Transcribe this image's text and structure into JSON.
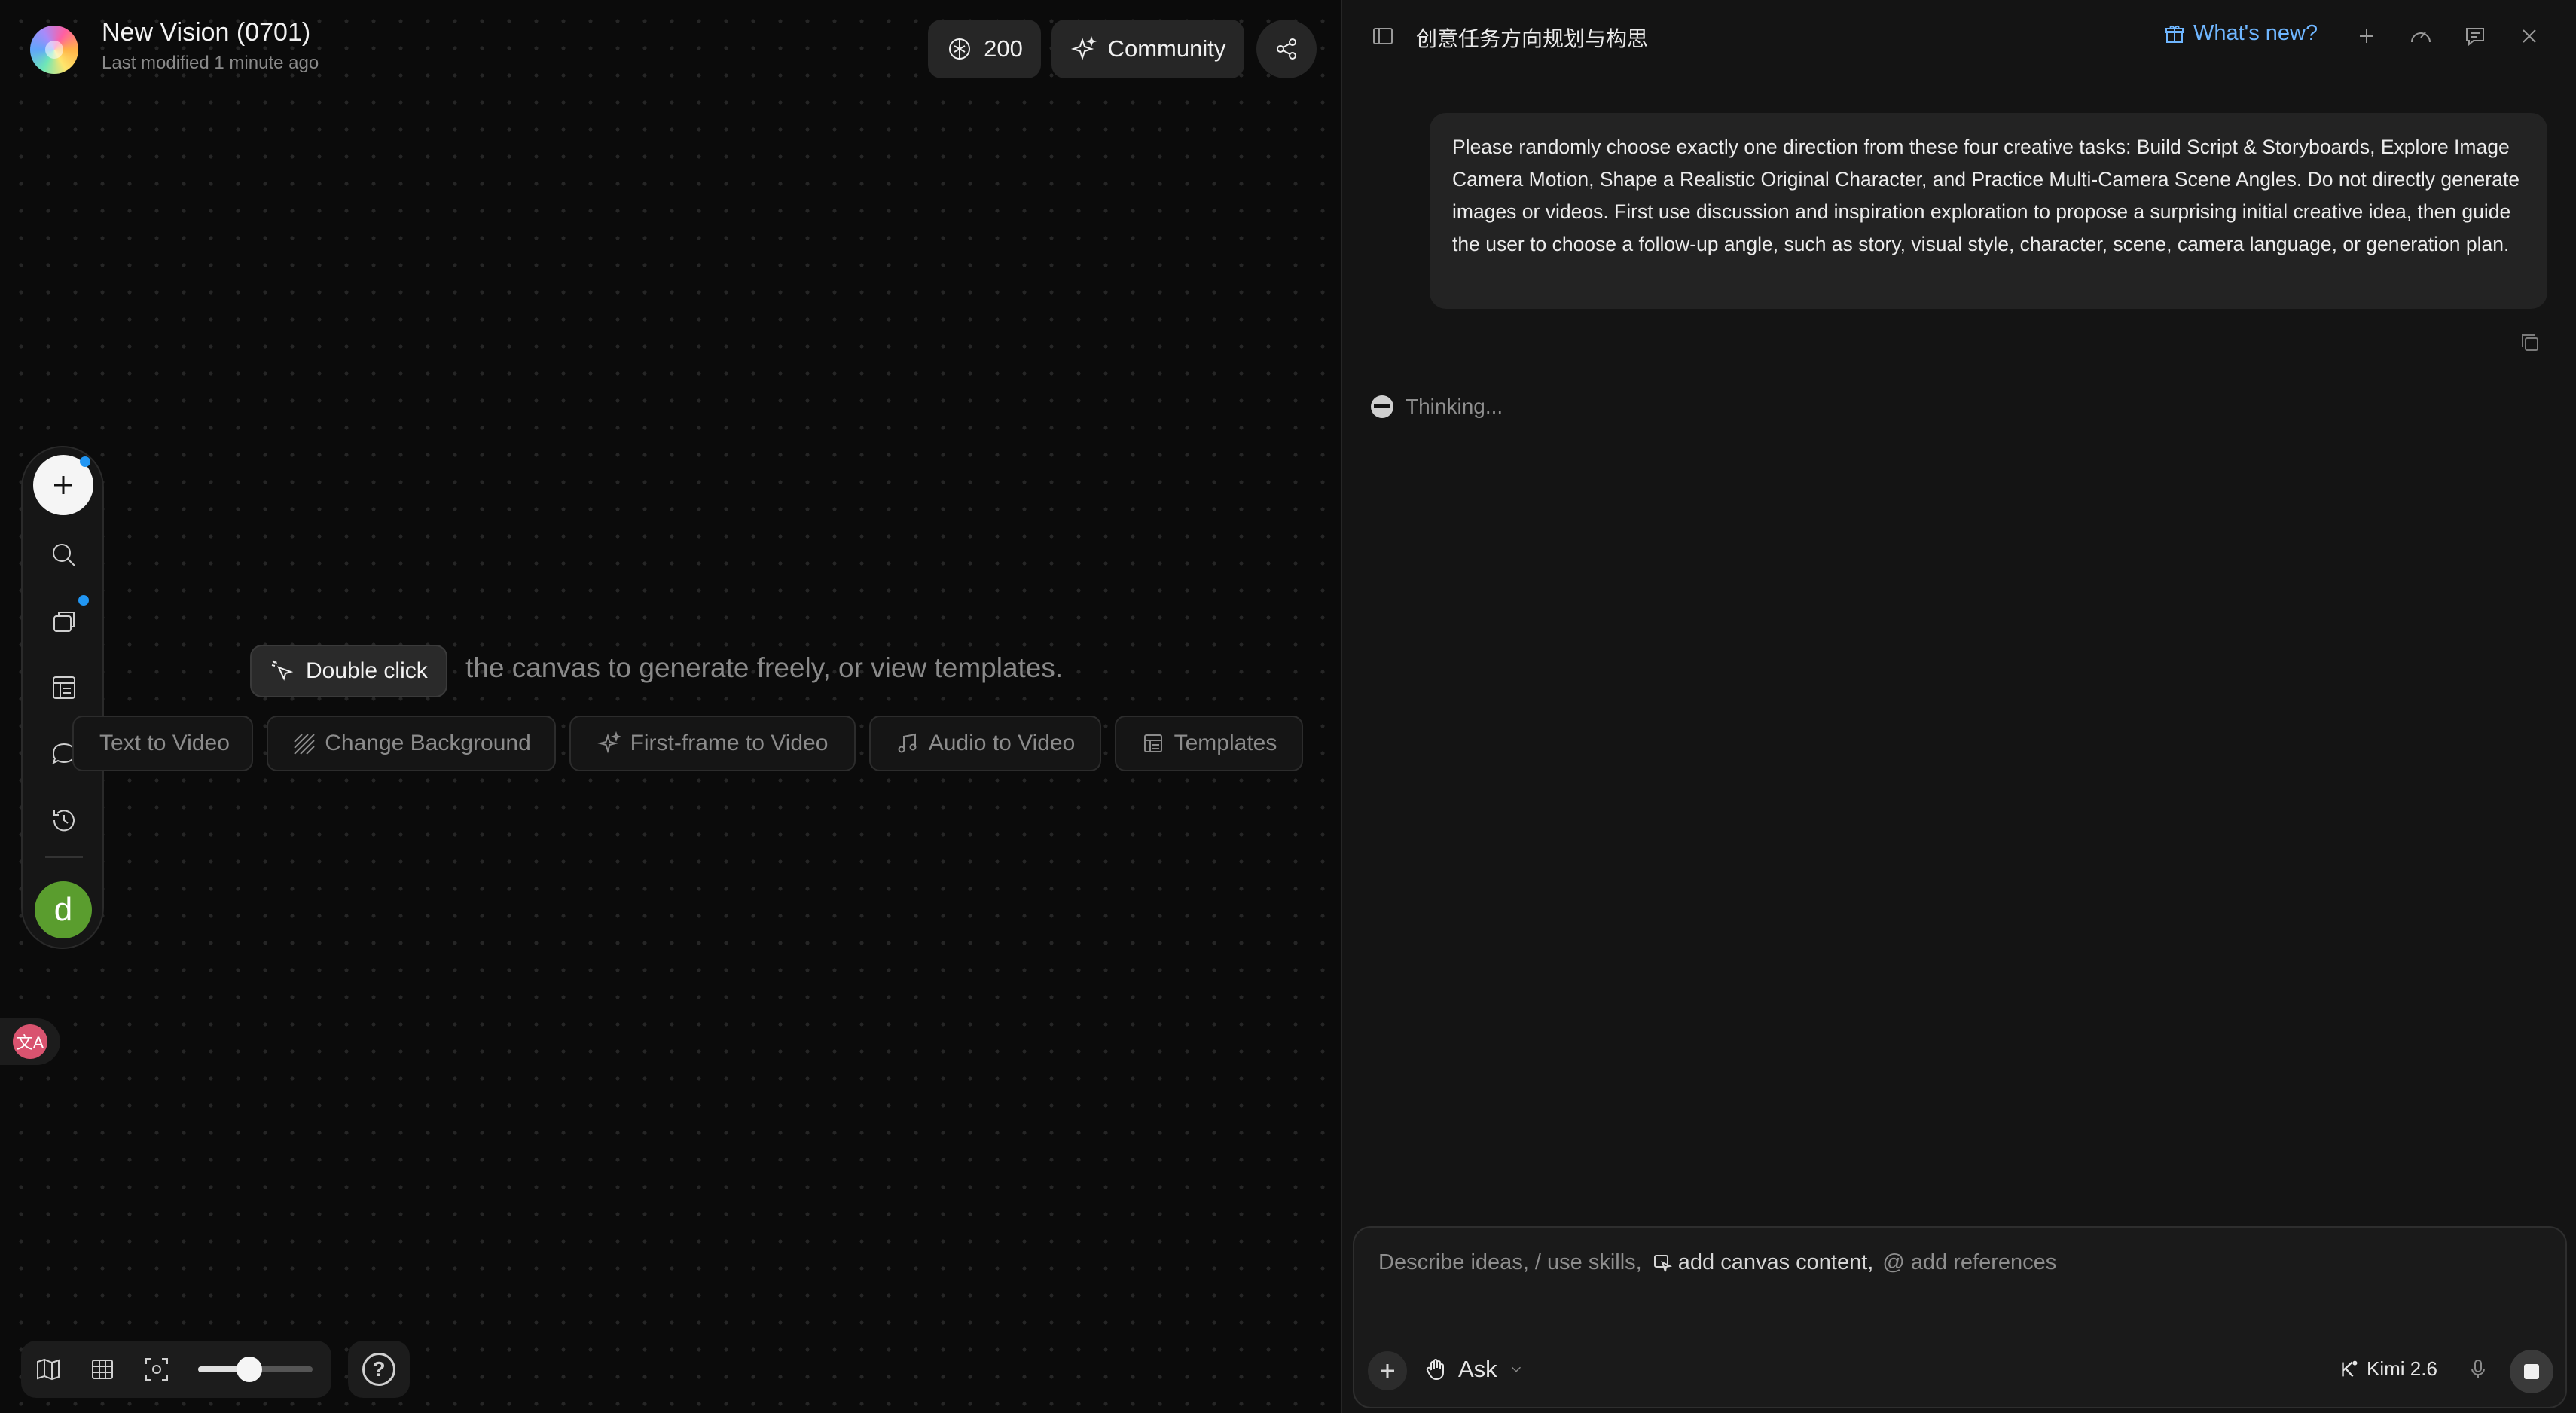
{
  "header": {
    "project_title": "New Vision (0701)",
    "last_modified": "Last modified 1 minute ago",
    "credits": "200",
    "community_label": "Community"
  },
  "canvas": {
    "double_click_label": "Double click",
    "hint_text": "the canvas to generate freely, or view templates.",
    "quick_actions": [
      {
        "label": "Text to Video",
        "icon": "text-video-icon"
      },
      {
        "label": "Change Background",
        "icon": "stripes-icon"
      },
      {
        "label": "First-frame to Video",
        "icon": "sparkle-icon"
      },
      {
        "label": "Audio to Video",
        "icon": "music-note-icon"
      },
      {
        "label": "Templates",
        "icon": "template-icon"
      }
    ]
  },
  "left_toolbar": {
    "avatar_letter": "d",
    "icons": [
      "plus-icon",
      "search-icon",
      "assets-icon",
      "layout-icon",
      "chat-icon",
      "history-icon"
    ]
  },
  "translate_badge": "文A",
  "bottom_bar": {
    "icons": [
      "map-icon",
      "grid-icon",
      "focus-icon"
    ],
    "zoom_level": 0.45,
    "help_label": "?"
  },
  "panel": {
    "title": "创意任务方向规划与构思",
    "whats_new": "What's new?",
    "user_message": "Please randomly choose exactly one direction from these four creative tasks: Build Script & Storyboards, Explore Image Camera Motion, Shape a Realistic Original Character, and Practice Multi-Camera Scene Angles. Do not directly generate images or videos. First use discussion and inspiration exploration to propose a surprising initial creative idea, then guide the user to choose a follow-up angle, such as story, visual style, character, scene, camera language, or generation plan.",
    "thinking": "Thinking...",
    "composer": {
      "placeholder_a": "Describe ideas, / use skills,",
      "placeholder_b": "add canvas content,",
      "placeholder_c": "@ add references",
      "mode": "Ask",
      "model": "Kimi 2.6"
    }
  },
  "colors": {
    "accent": "#6fb6ff",
    "notify_dot": "#2196f3",
    "avatar": "#5a9d2e"
  }
}
